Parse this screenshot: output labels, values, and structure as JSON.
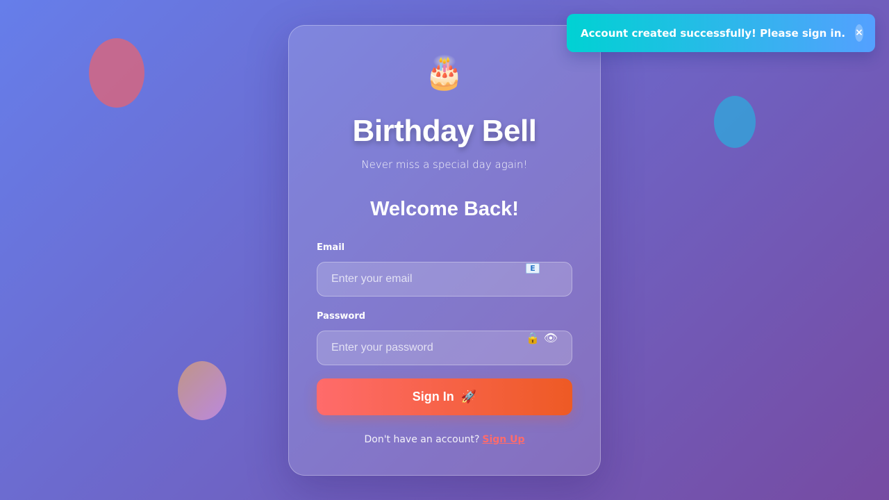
{
  "app": {
    "logo_icon": "birthday-cake-icon",
    "logo_glyph": "🎂",
    "title": "Birthday Bell",
    "tagline": "Never miss a special day again!"
  },
  "form": {
    "heading": "Welcome Back!",
    "email": {
      "label": "Email",
      "value": "",
      "placeholder": "Enter your email",
      "icon": "envelope-icon",
      "icon_glyph": "E"
    },
    "password": {
      "label": "Password",
      "value": "",
      "placeholder": "Enter your password",
      "lock_icon": "lock-icon",
      "lock_glyph": "🔒",
      "toggle_icon": "eye-icon",
      "toggle_glyph": "👁"
    },
    "submit": {
      "label": "Sign In",
      "icon": "rocket-icon",
      "icon_glyph": "🚀"
    },
    "signup_prompt": "Don't have an account?",
    "signup_link": "Sign Up"
  },
  "toast": {
    "message": "Account created successfully! Please sign in.",
    "close_glyph": "×",
    "colors": [
      "#00d2d3",
      "#54a0ff"
    ]
  },
  "colors": {
    "background_start": "#667eea",
    "background_end": "#764ba2",
    "button_start": "#ff6b6b",
    "button_end": "#ee5a24",
    "link": "#ff6b6b"
  }
}
